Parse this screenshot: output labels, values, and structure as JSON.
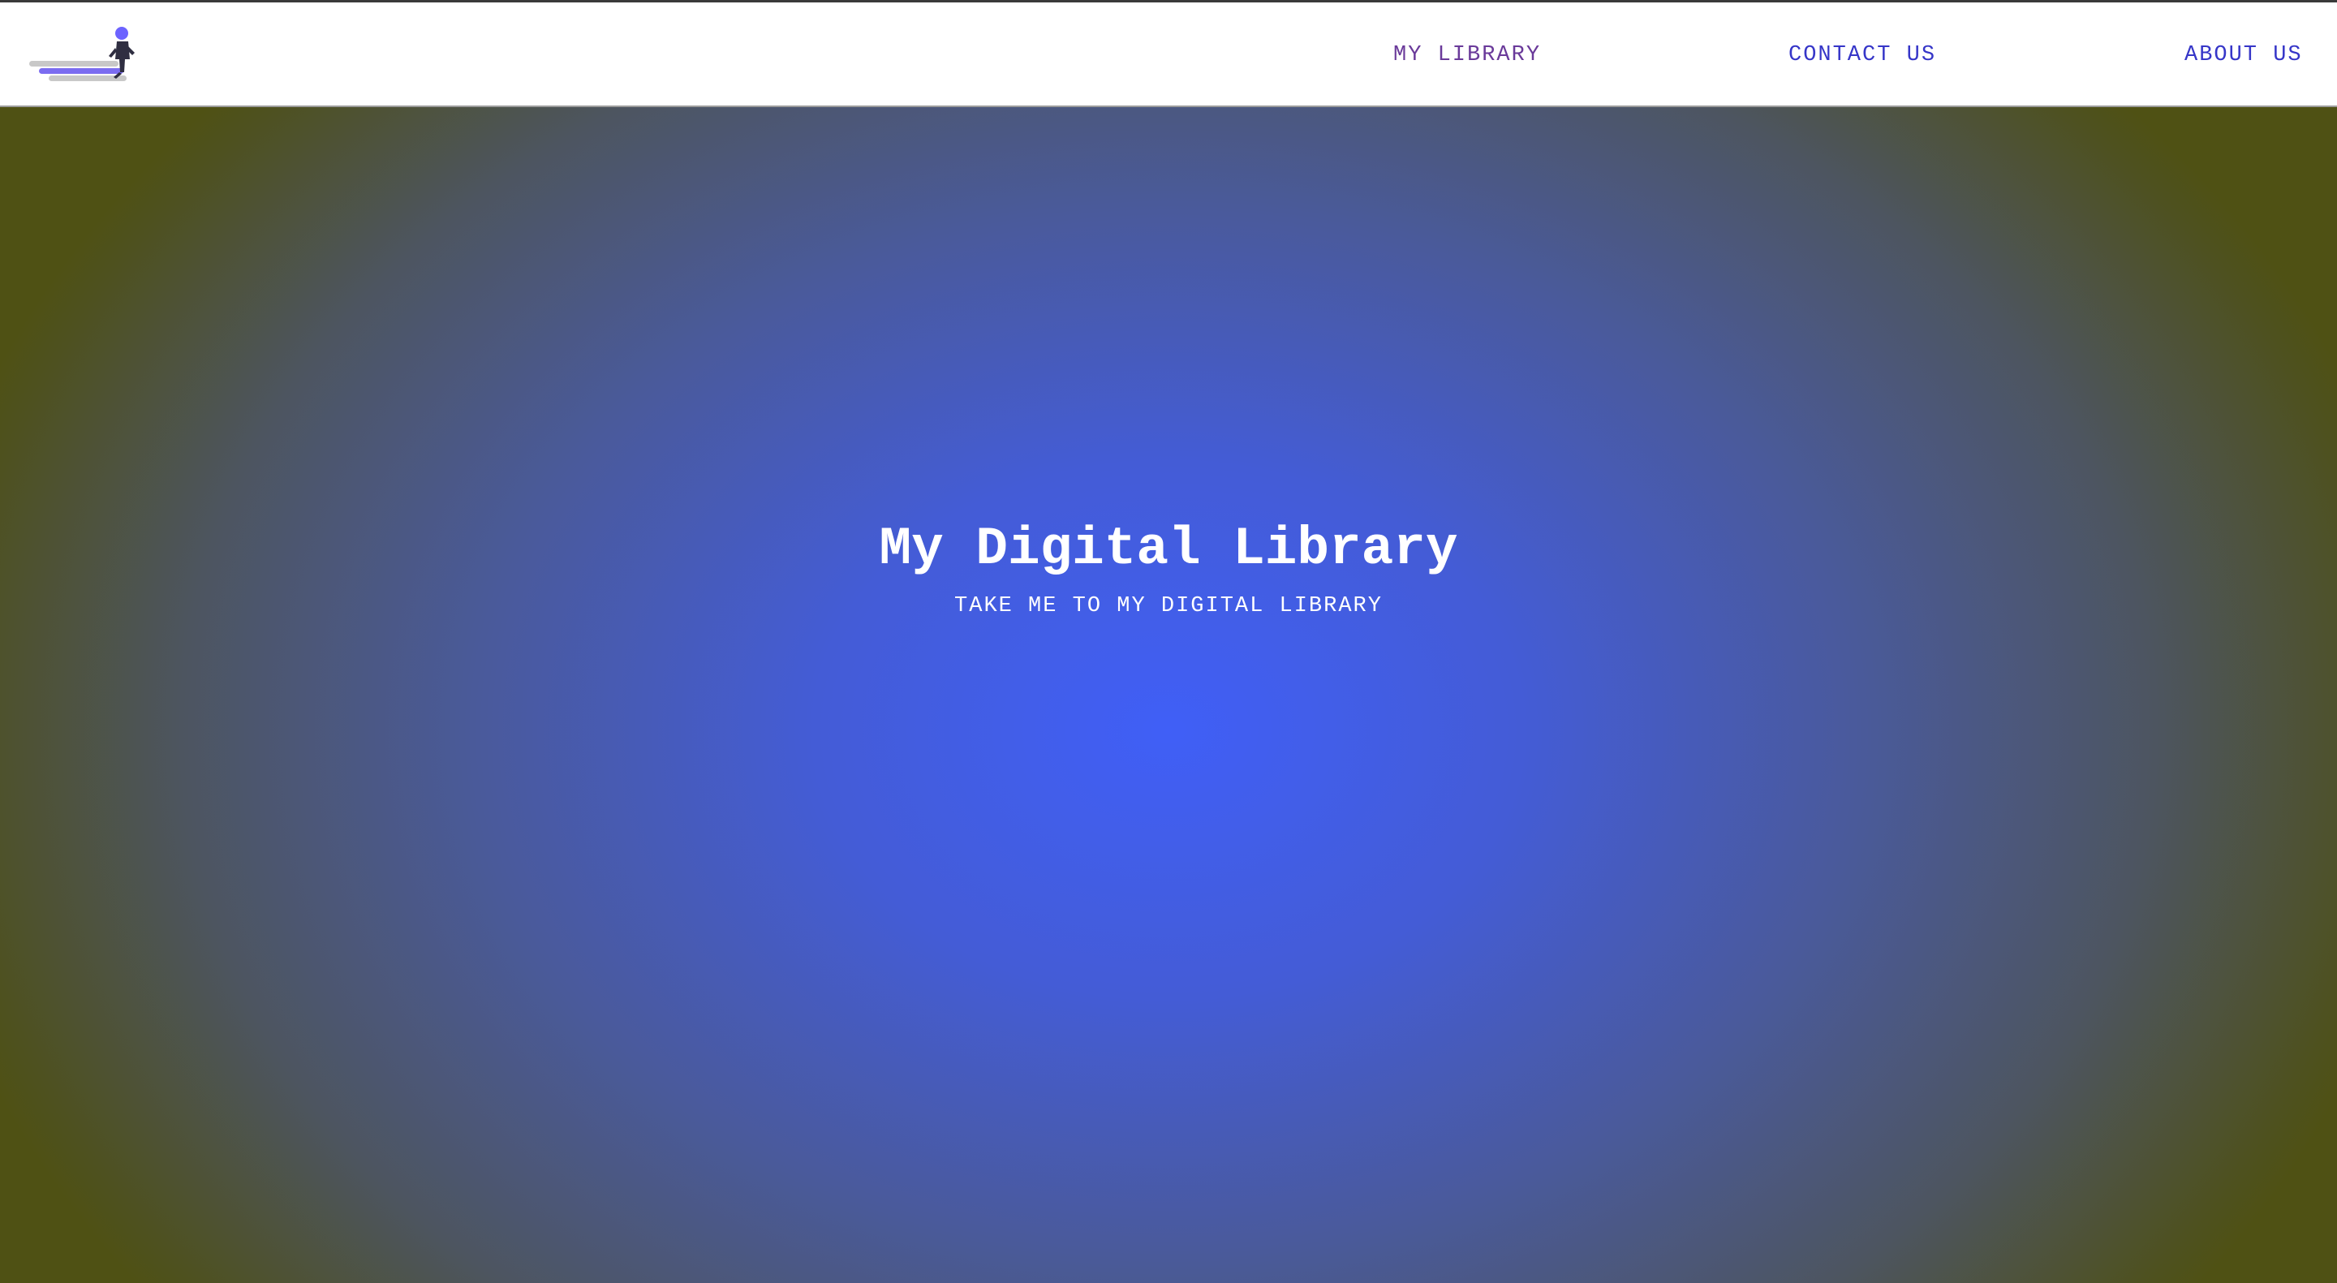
{
  "header": {
    "logo_icon": "reading-person-on-books-icon",
    "nav": {
      "my_library": "MY LIBRARY",
      "contact_us": "CONTACT US",
      "about_us": "ABOUT US"
    }
  },
  "hero": {
    "title": "My Digital Library",
    "cta": "TAKE ME TO MY DIGITAL LIBRARY"
  },
  "colors": {
    "accent_blue": "#405ff7",
    "nav_link": "#3636c8",
    "nav_link_visited": "#6a3a9a",
    "hero_edge": "#4f5114"
  }
}
